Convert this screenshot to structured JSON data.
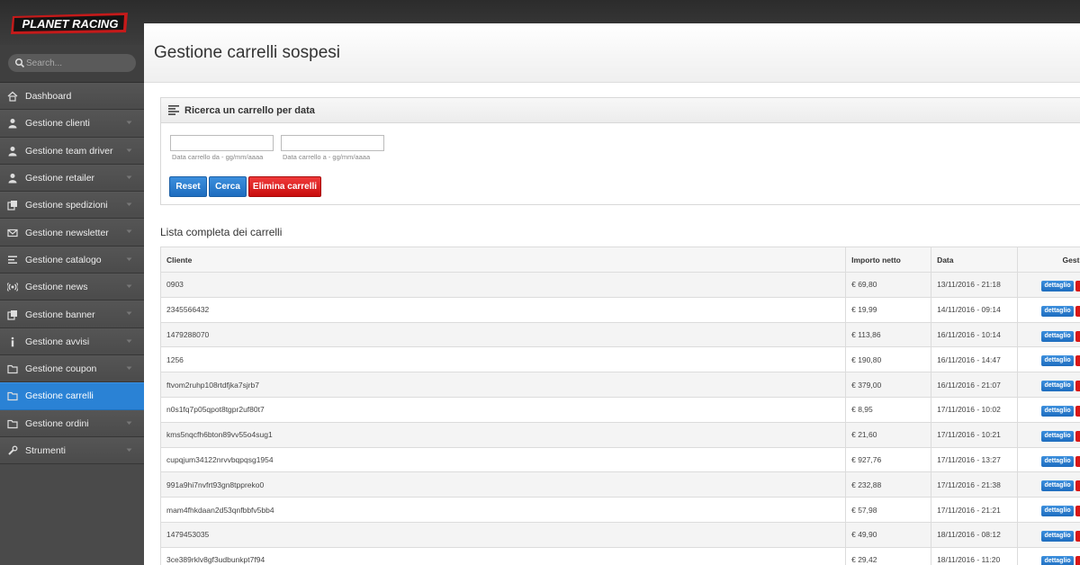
{
  "brand": {
    "logo_text": "PLANET RACING"
  },
  "sidebar": {
    "search_placeholder": "Search...",
    "items": [
      {
        "label": "Dashboard",
        "icon": "home-icon",
        "active": false,
        "has_submenu": false
      },
      {
        "label": "Gestione clienti",
        "icon": "user-icon",
        "active": false,
        "has_submenu": true
      },
      {
        "label": "Gestione team driver",
        "icon": "user-icon",
        "active": false,
        "has_submenu": true
      },
      {
        "label": "Gestione retailer",
        "icon": "user-icon",
        "active": false,
        "has_submenu": true
      },
      {
        "label": "Gestione spedizioni",
        "icon": "copy-icon",
        "active": false,
        "has_submenu": true
      },
      {
        "label": "Gestione newsletter",
        "icon": "envelope-icon",
        "active": false,
        "has_submenu": true
      },
      {
        "label": "Gestione catalogo",
        "icon": "list-icon",
        "active": false,
        "has_submenu": true
      },
      {
        "label": "Gestione news",
        "icon": "broadcast-icon",
        "active": false,
        "has_submenu": true
      },
      {
        "label": "Gestione banner",
        "icon": "copy-icon",
        "active": false,
        "has_submenu": true
      },
      {
        "label": "Gestione avvisi",
        "icon": "info-icon",
        "active": false,
        "has_submenu": true
      },
      {
        "label": "Gestione coupon",
        "icon": "folder-icon",
        "active": false,
        "has_submenu": true
      },
      {
        "label": "Gestione carrelli",
        "icon": "folder-icon",
        "active": true,
        "has_submenu": false
      },
      {
        "label": "Gestione ordini",
        "icon": "folder-icon",
        "active": false,
        "has_submenu": true
      },
      {
        "label": "Strumenti",
        "icon": "wrench-icon",
        "active": false,
        "has_submenu": true
      }
    ]
  },
  "page": {
    "title": "Gestione carrelli sospesi"
  },
  "search_panel": {
    "title": "Ricerca un carrello per data",
    "date_from_hint": "Data carrello da - gg/mm/aaaa",
    "date_to_hint": "Data carrello a - gg/mm/aaaa",
    "date_from_value": "",
    "date_to_value": "",
    "reset_label": "Reset",
    "search_label": "Cerca",
    "delete_label": "Elimina carrelli"
  },
  "cart_list": {
    "title": "Lista completa dei carrelli",
    "columns": [
      "Cliente",
      "Importo netto",
      "Data",
      "Gestio"
    ],
    "detail_label": "dettaglio",
    "rows": [
      {
        "cliente": "0903",
        "importo": "€ 69,80",
        "data": "13/11/2016 - 21:18"
      },
      {
        "cliente": "2345566432",
        "importo": "€ 19,99",
        "data": "14/11/2016 - 09:14"
      },
      {
        "cliente": "1479288070",
        "importo": "€ 113,86",
        "data": "16/11/2016 - 10:14"
      },
      {
        "cliente": "1256",
        "importo": "€ 190,80",
        "data": "16/11/2016 - 14:47"
      },
      {
        "cliente": "ftvom2ruhp108rtdfjka7sjrb7",
        "importo": "€ 379,00",
        "data": "16/11/2016 - 21:07"
      },
      {
        "cliente": "n0s1fq7p05qpot8tgpr2uf80t7",
        "importo": "€ 8,95",
        "data": "17/11/2016 - 10:02"
      },
      {
        "cliente": "kms5nqcfh6bton89vv55o4sug1",
        "importo": "€ 21,60",
        "data": "17/11/2016 - 10:21"
      },
      {
        "cliente": "cupqjum34122nrvvbqpqsg1954",
        "importo": "€ 927,76",
        "data": "17/11/2016 - 13:27"
      },
      {
        "cliente": "991a9hi7nvfrt93gn8tppreko0",
        "importo": "€ 232,88",
        "data": "17/11/2016 - 21:38"
      },
      {
        "cliente": "mam4fhkdaan2d53qnfbbfv5bb4",
        "importo": "€ 57,98",
        "data": "17/11/2016 - 21:21"
      },
      {
        "cliente": "1479453035",
        "importo": "€ 49,90",
        "data": "18/11/2016 - 08:12"
      },
      {
        "cliente": "3ce389rklv8gf3udbunkpt7f94",
        "importo": "€ 29,42",
        "data": "18/11/2016 - 11:20"
      }
    ]
  },
  "colors": {
    "accent": "#2a82d5",
    "danger": "#d81818",
    "sidebar_bg": "#4a4a4a"
  }
}
